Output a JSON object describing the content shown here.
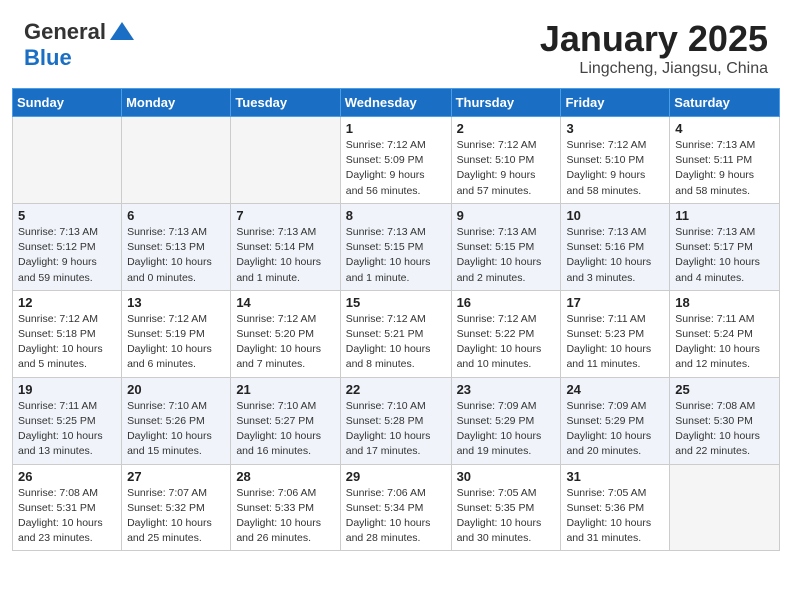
{
  "header": {
    "logo_line1": "General",
    "logo_line2": "Blue",
    "month_title": "January 2025",
    "location": "Lingcheng, Jiangsu, China"
  },
  "weekdays": [
    "Sunday",
    "Monday",
    "Tuesday",
    "Wednesday",
    "Thursday",
    "Friday",
    "Saturday"
  ],
  "weeks": [
    [
      {
        "day": "",
        "info": ""
      },
      {
        "day": "",
        "info": ""
      },
      {
        "day": "",
        "info": ""
      },
      {
        "day": "1",
        "info": "Sunrise: 7:12 AM\nSunset: 5:09 PM\nDaylight: 9 hours\nand 56 minutes."
      },
      {
        "day": "2",
        "info": "Sunrise: 7:12 AM\nSunset: 5:10 PM\nDaylight: 9 hours\nand 57 minutes."
      },
      {
        "day": "3",
        "info": "Sunrise: 7:12 AM\nSunset: 5:10 PM\nDaylight: 9 hours\nand 58 minutes."
      },
      {
        "day": "4",
        "info": "Sunrise: 7:13 AM\nSunset: 5:11 PM\nDaylight: 9 hours\nand 58 minutes."
      }
    ],
    [
      {
        "day": "5",
        "info": "Sunrise: 7:13 AM\nSunset: 5:12 PM\nDaylight: 9 hours\nand 59 minutes."
      },
      {
        "day": "6",
        "info": "Sunrise: 7:13 AM\nSunset: 5:13 PM\nDaylight: 10 hours\nand 0 minutes."
      },
      {
        "day": "7",
        "info": "Sunrise: 7:13 AM\nSunset: 5:14 PM\nDaylight: 10 hours\nand 1 minute."
      },
      {
        "day": "8",
        "info": "Sunrise: 7:13 AM\nSunset: 5:15 PM\nDaylight: 10 hours\nand 1 minute."
      },
      {
        "day": "9",
        "info": "Sunrise: 7:13 AM\nSunset: 5:15 PM\nDaylight: 10 hours\nand 2 minutes."
      },
      {
        "day": "10",
        "info": "Sunrise: 7:13 AM\nSunset: 5:16 PM\nDaylight: 10 hours\nand 3 minutes."
      },
      {
        "day": "11",
        "info": "Sunrise: 7:13 AM\nSunset: 5:17 PM\nDaylight: 10 hours\nand 4 minutes."
      }
    ],
    [
      {
        "day": "12",
        "info": "Sunrise: 7:12 AM\nSunset: 5:18 PM\nDaylight: 10 hours\nand 5 minutes."
      },
      {
        "day": "13",
        "info": "Sunrise: 7:12 AM\nSunset: 5:19 PM\nDaylight: 10 hours\nand 6 minutes."
      },
      {
        "day": "14",
        "info": "Sunrise: 7:12 AM\nSunset: 5:20 PM\nDaylight: 10 hours\nand 7 minutes."
      },
      {
        "day": "15",
        "info": "Sunrise: 7:12 AM\nSunset: 5:21 PM\nDaylight: 10 hours\nand 8 minutes."
      },
      {
        "day": "16",
        "info": "Sunrise: 7:12 AM\nSunset: 5:22 PM\nDaylight: 10 hours\nand 10 minutes."
      },
      {
        "day": "17",
        "info": "Sunrise: 7:11 AM\nSunset: 5:23 PM\nDaylight: 10 hours\nand 11 minutes."
      },
      {
        "day": "18",
        "info": "Sunrise: 7:11 AM\nSunset: 5:24 PM\nDaylight: 10 hours\nand 12 minutes."
      }
    ],
    [
      {
        "day": "19",
        "info": "Sunrise: 7:11 AM\nSunset: 5:25 PM\nDaylight: 10 hours\nand 13 minutes."
      },
      {
        "day": "20",
        "info": "Sunrise: 7:10 AM\nSunset: 5:26 PM\nDaylight: 10 hours\nand 15 minutes."
      },
      {
        "day": "21",
        "info": "Sunrise: 7:10 AM\nSunset: 5:27 PM\nDaylight: 10 hours\nand 16 minutes."
      },
      {
        "day": "22",
        "info": "Sunrise: 7:10 AM\nSunset: 5:28 PM\nDaylight: 10 hours\nand 17 minutes."
      },
      {
        "day": "23",
        "info": "Sunrise: 7:09 AM\nSunset: 5:29 PM\nDaylight: 10 hours\nand 19 minutes."
      },
      {
        "day": "24",
        "info": "Sunrise: 7:09 AM\nSunset: 5:29 PM\nDaylight: 10 hours\nand 20 minutes."
      },
      {
        "day": "25",
        "info": "Sunrise: 7:08 AM\nSunset: 5:30 PM\nDaylight: 10 hours\nand 22 minutes."
      }
    ],
    [
      {
        "day": "26",
        "info": "Sunrise: 7:08 AM\nSunset: 5:31 PM\nDaylight: 10 hours\nand 23 minutes."
      },
      {
        "day": "27",
        "info": "Sunrise: 7:07 AM\nSunset: 5:32 PM\nDaylight: 10 hours\nand 25 minutes."
      },
      {
        "day": "28",
        "info": "Sunrise: 7:06 AM\nSunset: 5:33 PM\nDaylight: 10 hours\nand 26 minutes."
      },
      {
        "day": "29",
        "info": "Sunrise: 7:06 AM\nSunset: 5:34 PM\nDaylight: 10 hours\nand 28 minutes."
      },
      {
        "day": "30",
        "info": "Sunrise: 7:05 AM\nSunset: 5:35 PM\nDaylight: 10 hours\nand 30 minutes."
      },
      {
        "day": "31",
        "info": "Sunrise: 7:05 AM\nSunset: 5:36 PM\nDaylight: 10 hours\nand 31 minutes."
      },
      {
        "day": "",
        "info": ""
      }
    ]
  ]
}
